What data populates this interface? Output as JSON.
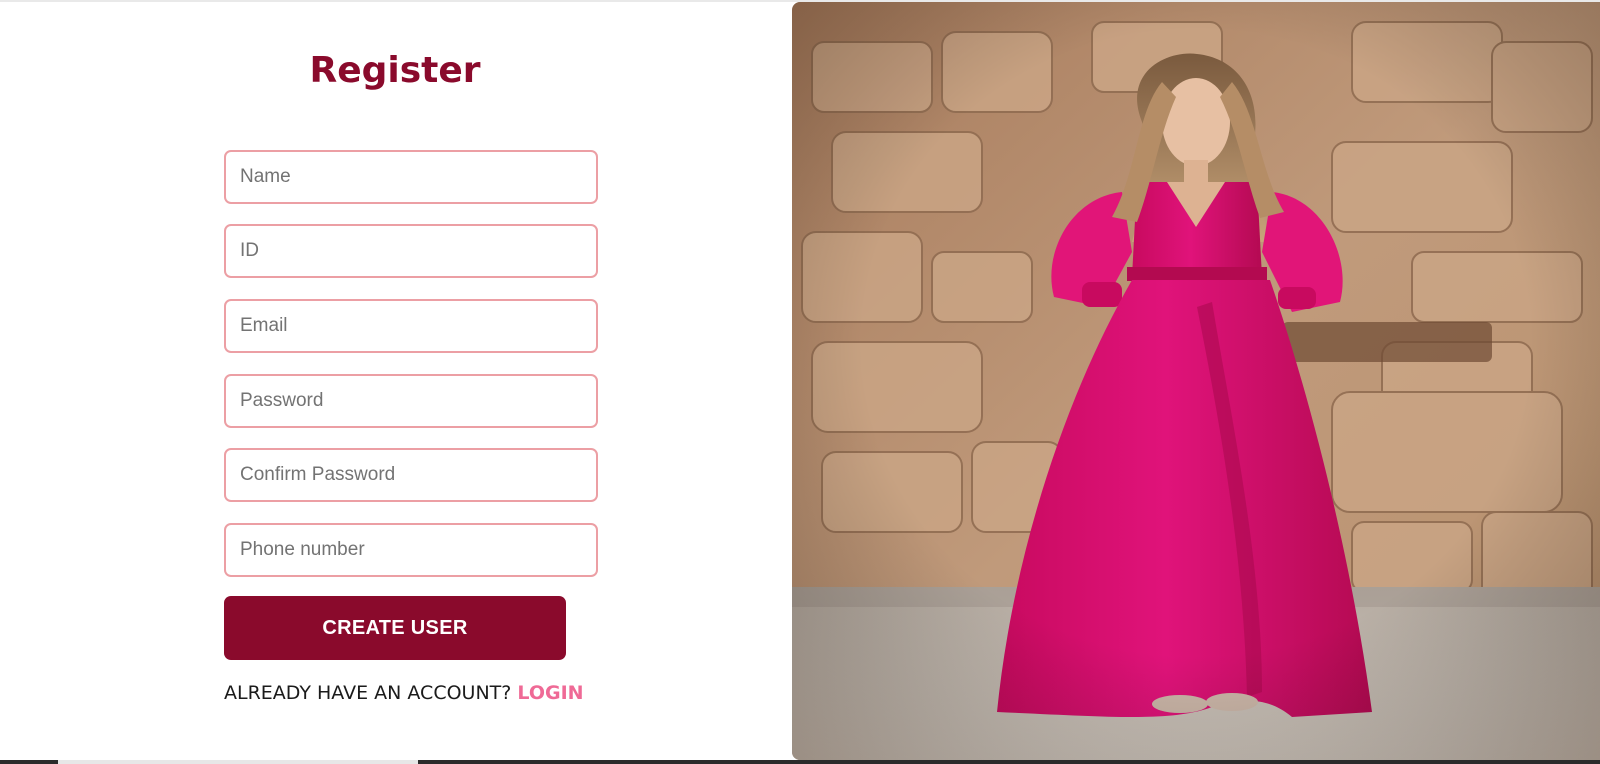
{
  "register": {
    "title": "Register",
    "fields": {
      "name_placeholder": "Name",
      "id_placeholder": "ID",
      "email_placeholder": "Email",
      "password_placeholder": "Password",
      "confirm_password_placeholder": "Confirm Password",
      "phone_placeholder": "Phone number"
    },
    "create_button_label": "CREATE USER",
    "login_prompt": "ALREADY HAVE AN ACCOUNT?",
    "login_link_label": "LOGIN"
  },
  "colors": {
    "brand": "#8a0a2c",
    "field_border": "#ec9fa4",
    "login_link": "#ef6a96",
    "dress": "#d3106a"
  },
  "hero_image": {
    "subject": "woman in pink wrap dress standing before a stone wall"
  }
}
